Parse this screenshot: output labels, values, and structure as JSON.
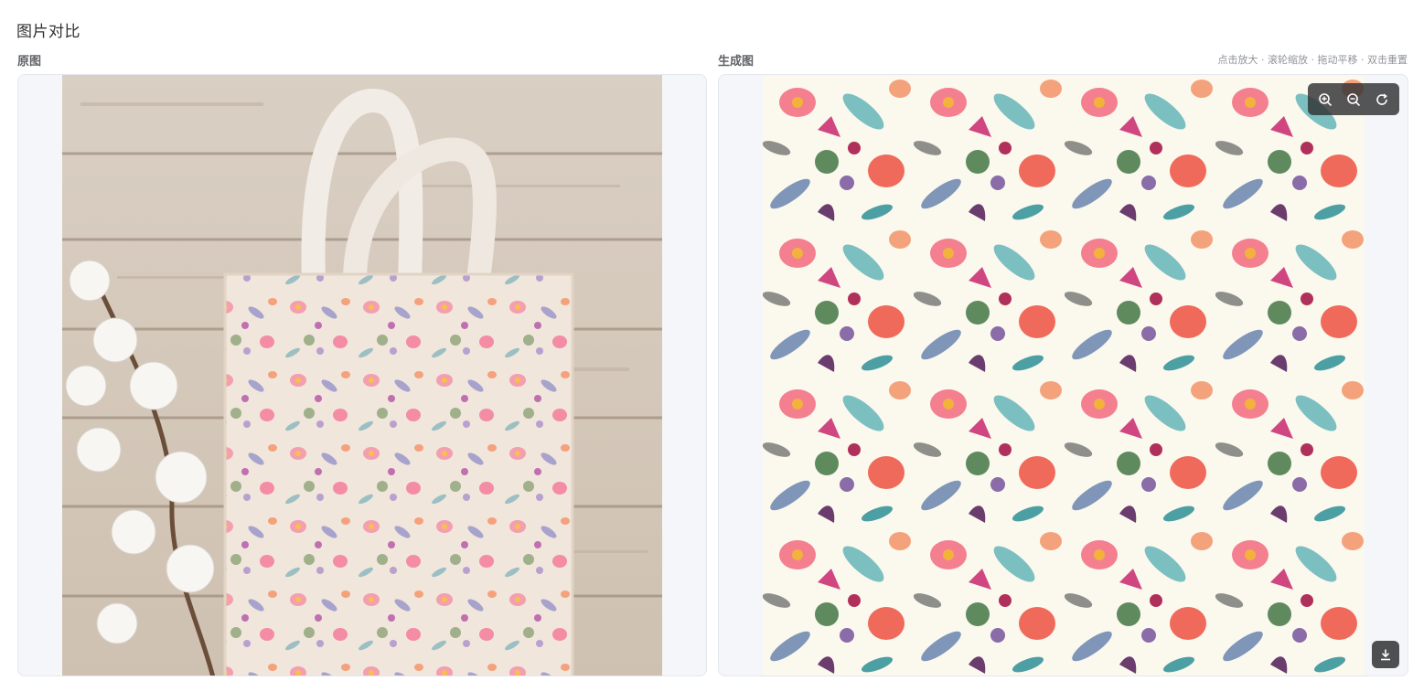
{
  "page": {
    "title": "图片对比"
  },
  "original": {
    "label": "原图",
    "description_icon": "tote-bag-photo"
  },
  "generated": {
    "label": "生成图",
    "hint": "点击放大 · 滚轮缩放 · 拖动平移 · 双击重置",
    "pattern_icon": "floral-watercolor-pattern"
  },
  "toolbar": {
    "zoom_in_icon": "zoom-in-icon",
    "zoom_out_icon": "zoom-out-icon",
    "reset_icon": "reset-icon",
    "download_icon": "download-icon"
  },
  "colors": {
    "frame_bg": "#f5f6f9",
    "toolbar_bg": "#303133"
  }
}
